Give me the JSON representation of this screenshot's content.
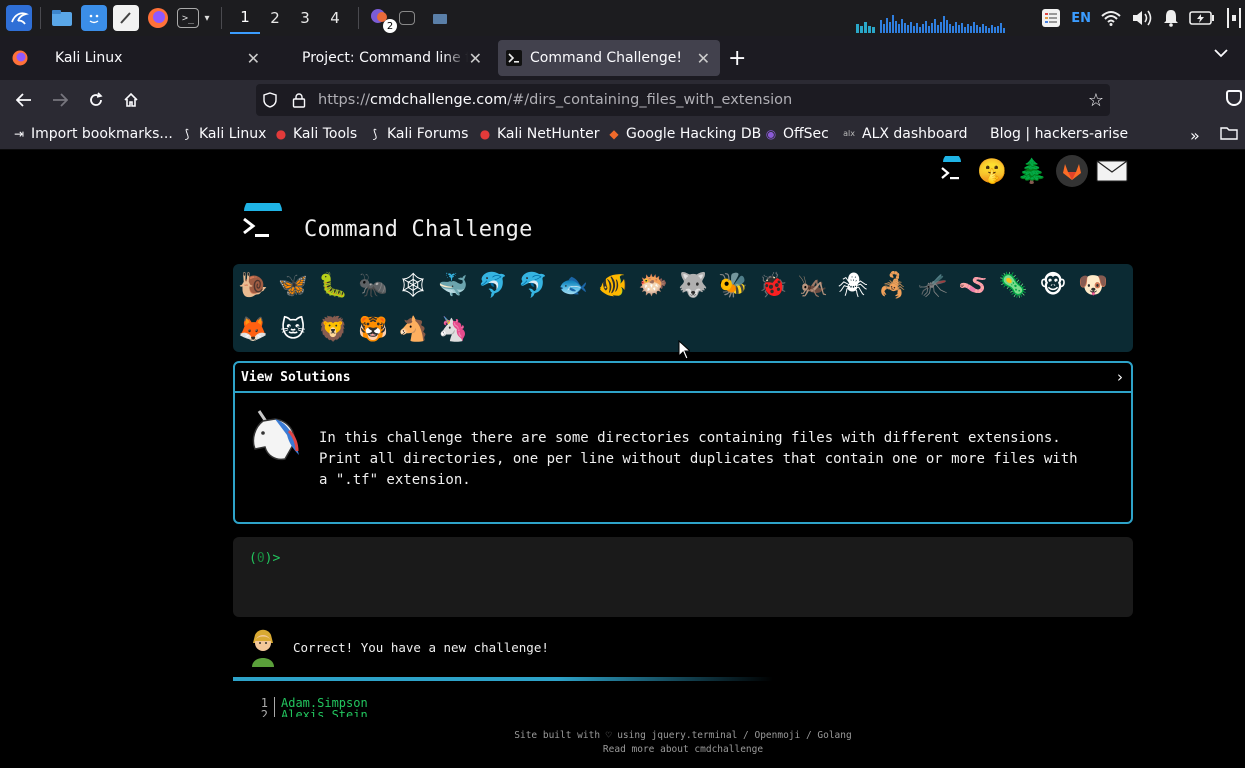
{
  "taskbar": {
    "workspaces": [
      "1",
      "2",
      "3",
      "4"
    ],
    "active_workspace": "1",
    "notification_count": "2",
    "language": "EN"
  },
  "browser": {
    "tabs": [
      {
        "title": "Kali Linux",
        "icon": "firefox-icon",
        "active": false
      },
      {
        "title": "Project: Command line fo",
        "icon": "",
        "active": false
      },
      {
        "title": "Command Challenge!",
        "icon": "terminal-icon",
        "active": true
      }
    ],
    "url_prefix": "https://",
    "url_domain": "cmdchallenge.com",
    "url_path": "/#/dirs_containing_files_with_extension",
    "bookmarks": [
      {
        "label": "Import bookmarks...",
        "icon": "import-icon"
      },
      {
        "label": "Kali Linux",
        "icon": "kali-dragon-icon"
      },
      {
        "label": "Kali Tools",
        "icon": "kali-tools-icon"
      },
      {
        "label": "Kali Forums",
        "icon": "kali-forums-icon"
      },
      {
        "label": "Kali NetHunter",
        "icon": "kali-nethunter-icon"
      },
      {
        "label": "Google Hacking DB",
        "icon": "ghdb-icon"
      },
      {
        "label": "OffSec",
        "icon": "offsec-icon"
      },
      {
        "label": "ALX dashboard",
        "icon": "alx-icon"
      },
      {
        "label": "Blog | hackers-arise",
        "icon": ""
      }
    ]
  },
  "page": {
    "title": "Command Challenge",
    "challenge_icons_row1": [
      "🐌",
      "🦋",
      "🐛",
      "🐜",
      "🕸",
      "🐳",
      "🐬",
      "🐬",
      "🐟",
      "🐠",
      "🐡",
      "🐺",
      "🐝",
      "🐞",
      "🦗",
      "🕷",
      "🦂",
      "🦟",
      "🪱",
      "🦠",
      "🐵",
      "🐶"
    ],
    "challenge_icons_row2": [
      "🦊",
      "🐱",
      "🦁",
      "🐯",
      "🐴",
      "🦄"
    ],
    "solutions_label": "View Solutions",
    "solutions_chevron": "›",
    "description": "In this challenge there are some directories containing files with different extensions.\nPrint all directories, one per line without duplicates that contain one or more files with\na \".tf\" extension.",
    "prompt_open": "(",
    "prompt_num": "0",
    "prompt_close": ")>",
    "correct_message": "Correct! You have a new challenge!",
    "listing": [
      {
        "n": "1",
        "v": "Adam.Simpson"
      },
      {
        "n": "2",
        "v": "Alexis.Stein"
      }
    ],
    "footer_line1": "Site built with ♡ using jquery.terminal / Openmoji / Golang",
    "footer_line2": "Read more about cmdchallenge"
  }
}
